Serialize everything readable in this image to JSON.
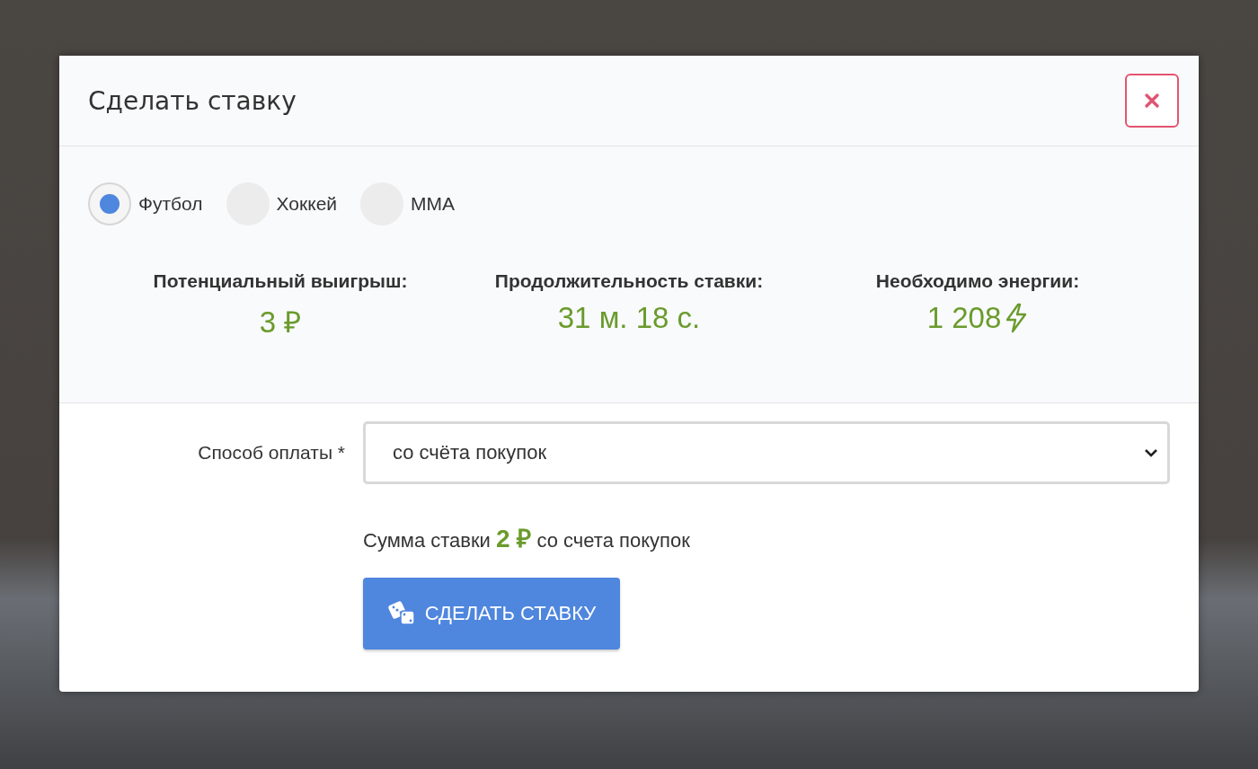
{
  "modal": {
    "title": "Сделать ставку"
  },
  "sports": [
    {
      "label": "Футбол",
      "selected": true
    },
    {
      "label": "Хоккей",
      "selected": false
    },
    {
      "label": "MMA",
      "selected": false
    }
  ],
  "stats": [
    {
      "kind": "money",
      "label": "Потенциальный выигрыш:",
      "value": "3 ₽"
    },
    {
      "kind": "time",
      "label": "Продолжительность ставки:",
      "value": "31 м. 18 с."
    },
    {
      "kind": "energy",
      "label": "Необходимо энергии:",
      "value": "1 208"
    }
  ],
  "payment": {
    "label": "Способ оплаты *",
    "value": "со счёта покупок"
  },
  "summary": "Сумма ставки **2 ₽** со счета покупок",
  "submit": "СДЕЛАТЬ СТАВКУ"
}
